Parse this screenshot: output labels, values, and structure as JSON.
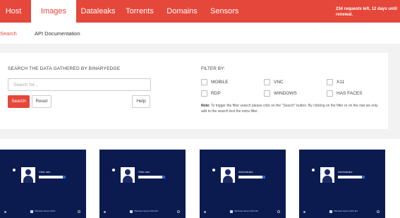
{
  "topnav": {
    "tabs": [
      {
        "label": "Host",
        "active": false
      },
      {
        "label": "Images",
        "active": true
      },
      {
        "label": "Dataleaks",
        "active": false
      },
      {
        "label": "Torrents",
        "active": false
      },
      {
        "label": "Domains",
        "active": false
      },
      {
        "label": "Sensors",
        "active": false
      }
    ],
    "requests_text": "234 requests left, 12 days until renewal."
  },
  "subnav": {
    "links": [
      {
        "label": "Search",
        "active": true
      },
      {
        "label": "API Documentation",
        "active": false
      }
    ]
  },
  "search_panel": {
    "title": "SEARCH THE DATA GATHERED BY BINARYEDGE",
    "input_placeholder": "Search for...",
    "input_value": "",
    "search_button": "Search",
    "reset_button": "Reset",
    "help_button": "Help"
  },
  "filters": {
    "title": "FILTER BY:",
    "options": [
      "MOBILE",
      "VNC",
      "X11",
      "RDP",
      "WINDOWS",
      "HAS FACES"
    ],
    "note_label": "Note:",
    "note_text": "To trigger the filter search please click on the \"Search\" button. By clicking on the filter or on the stat we only add to the search text the extra filter."
  },
  "results": {
    "cards": [
      {
        "user": "Other user",
        "os": "Windows Server 2012"
      },
      {
        "user": "Other user",
        "os": "Windows Server 2012 R2"
      },
      {
        "user": "Administrator",
        "os": "Windows Server 2012 R2"
      },
      {
        "user": "Administrator",
        "os": "Windows Server 2012 R2"
      }
    ]
  },
  "colors": {
    "accent": "#e5473a",
    "screen_bg": "#0c1b4f"
  }
}
